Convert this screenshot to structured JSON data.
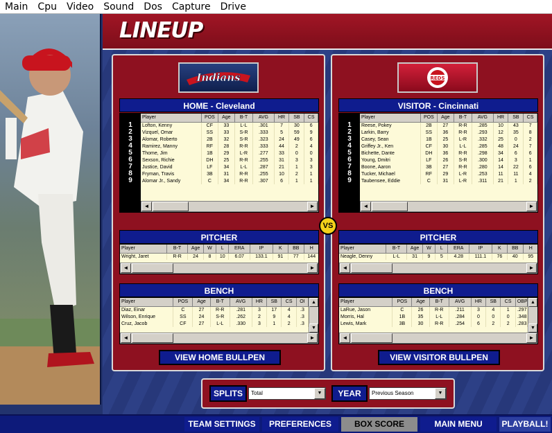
{
  "menubar": {
    "items": [
      "Main",
      "Cpu",
      "Video",
      "Sound",
      "Dos",
      "Capture",
      "Drive"
    ]
  },
  "title": "LINEUP",
  "vs_label": "VS",
  "home": {
    "header": "HOME - Cleveland",
    "logo_text": "Indians",
    "lineup": {
      "columns": [
        "Player",
        "POS",
        "Age",
        "B-T",
        "AVG",
        "HR",
        "SB",
        "CS"
      ],
      "order": [
        "1",
        "2",
        "3",
        "4",
        "5",
        "6",
        "7",
        "8",
        "9"
      ],
      "rows": [
        [
          "Lofton, Kenny",
          "CF",
          "33",
          "L-L",
          ".301",
          "7",
          "30",
          "6"
        ],
        [
          "Vizquel, Omar",
          "SS",
          "33",
          "S-R",
          ".333",
          "5",
          "59",
          "9"
        ],
        [
          "Alomar, Roberto",
          "2B",
          "32",
          "S-R",
          ".323",
          "24",
          "49",
          "6"
        ],
        [
          "Ramirez, Manny",
          "RF",
          "28",
          "R-R",
          ".333",
          "44",
          "2",
          "4"
        ],
        [
          "Thome, Jim",
          "1B",
          "29",
          "L-R",
          ".277",
          "33",
          "0",
          "0"
        ],
        [
          "Sexson, Richie",
          "DH",
          "25",
          "R-R",
          ".255",
          "31",
          "3",
          "3"
        ],
        [
          "Justice, David",
          "LF",
          "34",
          "L-L",
          ".287",
          "21",
          "1",
          "3"
        ],
        [
          "Fryman, Travis",
          "3B",
          "31",
          "R-R",
          ".255",
          "10",
          "2",
          "1"
        ],
        [
          "Alomar Jr., Sandy",
          "C",
          "34",
          "R-R",
          ".307",
          "6",
          "1",
          "1"
        ]
      ]
    },
    "pitcher": {
      "header": "PITCHER",
      "columns": [
        "Player",
        "B-T",
        "Age",
        "W",
        "L",
        "ERA",
        "IP",
        "K",
        "BB",
        "H"
      ],
      "rows": [
        [
          "Wright, Jaret",
          "R-R",
          "24",
          "8",
          "10",
          "6.07",
          "133.1",
          "91",
          "77",
          "144"
        ]
      ]
    },
    "bench": {
      "header": "BENCH",
      "columns": [
        "Player",
        "POS",
        "Age",
        "B-T",
        "AVG",
        "HR",
        "SB",
        "CS",
        "OI"
      ],
      "rows": [
        [
          "Diaz, Einar",
          "C",
          "27",
          "R-R",
          ".281",
          "3",
          "17",
          "4",
          ".3"
        ],
        [
          "Wilson, Enrique",
          "SS",
          "24",
          "S-R",
          ".262",
          "2",
          "9",
          "4",
          ".3"
        ],
        [
          "Cruz, Jacob",
          "CF",
          "27",
          "L-L",
          ".330",
          "3",
          "1",
          "2",
          ".3"
        ]
      ]
    },
    "bullpen_label": "VIEW HOME BULLPEN"
  },
  "visitor": {
    "header": "VISITOR - Cincinnati",
    "logo_text": "REDS",
    "lineup": {
      "columns": [
        "Player",
        "POS",
        "Age",
        "B-T",
        "AVG",
        "HR",
        "SB",
        "CS"
      ],
      "order": [
        "1",
        "2",
        "3",
        "4",
        "5",
        "6",
        "7",
        "8",
        "9"
      ],
      "rows": [
        [
          "Reese, Pokey",
          "2B",
          "27",
          "R-R",
          ".285",
          "10",
          "43",
          "7"
        ],
        [
          "Larkin, Barry",
          "SS",
          "36",
          "R-R",
          ".293",
          "12",
          "35",
          "8"
        ],
        [
          "Casey, Sean",
          "1B",
          "25",
          "L-R",
          ".332",
          "25",
          "0",
          "2"
        ],
        [
          "Griffey Jr., Ken",
          "CF",
          "30",
          "L-L",
          ".285",
          "48",
          "24",
          "7"
        ],
        [
          "Bichette, Dante",
          "DH",
          "36",
          "R-R",
          ".298",
          "34",
          "6",
          "6"
        ],
        [
          "Young, Dmitri",
          "LF",
          "26",
          "S-R",
          ".300",
          "14",
          "3",
          "1"
        ],
        [
          "Boone, Aaron",
          "3B",
          "27",
          "R-R",
          ".280",
          "14",
          "22",
          "6"
        ],
        [
          "Tucker, Michael",
          "RF",
          "29",
          "L-R",
          ".253",
          "11",
          "11",
          "4"
        ],
        [
          "Taubensee, Eddie",
          "C",
          "31",
          "L-R",
          ".311",
          "21",
          "1",
          "2"
        ]
      ]
    },
    "pitcher": {
      "header": "PITCHER",
      "columns": [
        "Player",
        "B-T",
        "Age",
        "W",
        "L",
        "ERA",
        "IP",
        "K",
        "BB",
        "H"
      ],
      "rows": [
        [
          "Neagle, Denny",
          "L-L",
          "31",
          "9",
          "5",
          "4.28",
          "111.1",
          "76",
          "40",
          "95"
        ]
      ]
    },
    "bench": {
      "header": "BENCH",
      "columns": [
        "Player",
        "POS",
        "Age",
        "B-T",
        "AVG",
        "HR",
        "SB",
        "CS",
        "OBP"
      ],
      "rows": [
        [
          "LaRue, Jason",
          "C",
          "26",
          "R-R",
          ".211",
          "3",
          "4",
          "1",
          ".297"
        ],
        [
          "Morris, Hal",
          "1B",
          "35",
          "L-L",
          ".284",
          "0",
          "0",
          "0",
          ".348"
        ],
        [
          "Lewis, Mark",
          "3B",
          "30",
          "R-R",
          ".254",
          "6",
          "2",
          "2",
          ".283"
        ]
      ]
    },
    "bullpen_label": "VIEW VISITOR BULLPEN"
  },
  "controls": {
    "splits_label": "SPLITS",
    "splits_value": "Total",
    "year_label": "YEAR",
    "year_value": "Previous Season"
  },
  "bottom_nav": {
    "team_settings": "TEAM SETTINGS",
    "preferences": "PREFERENCES",
    "box_score": "BOX SCORE",
    "main_menu": "MAIN MENU",
    "playball": "PLAYBALL!"
  },
  "colors": {
    "panel_red": "#8e1120",
    "header_blue": "#0f1c8e",
    "grid_cream": "#fdfad8",
    "vs_yellow": "#f4d21a"
  }
}
